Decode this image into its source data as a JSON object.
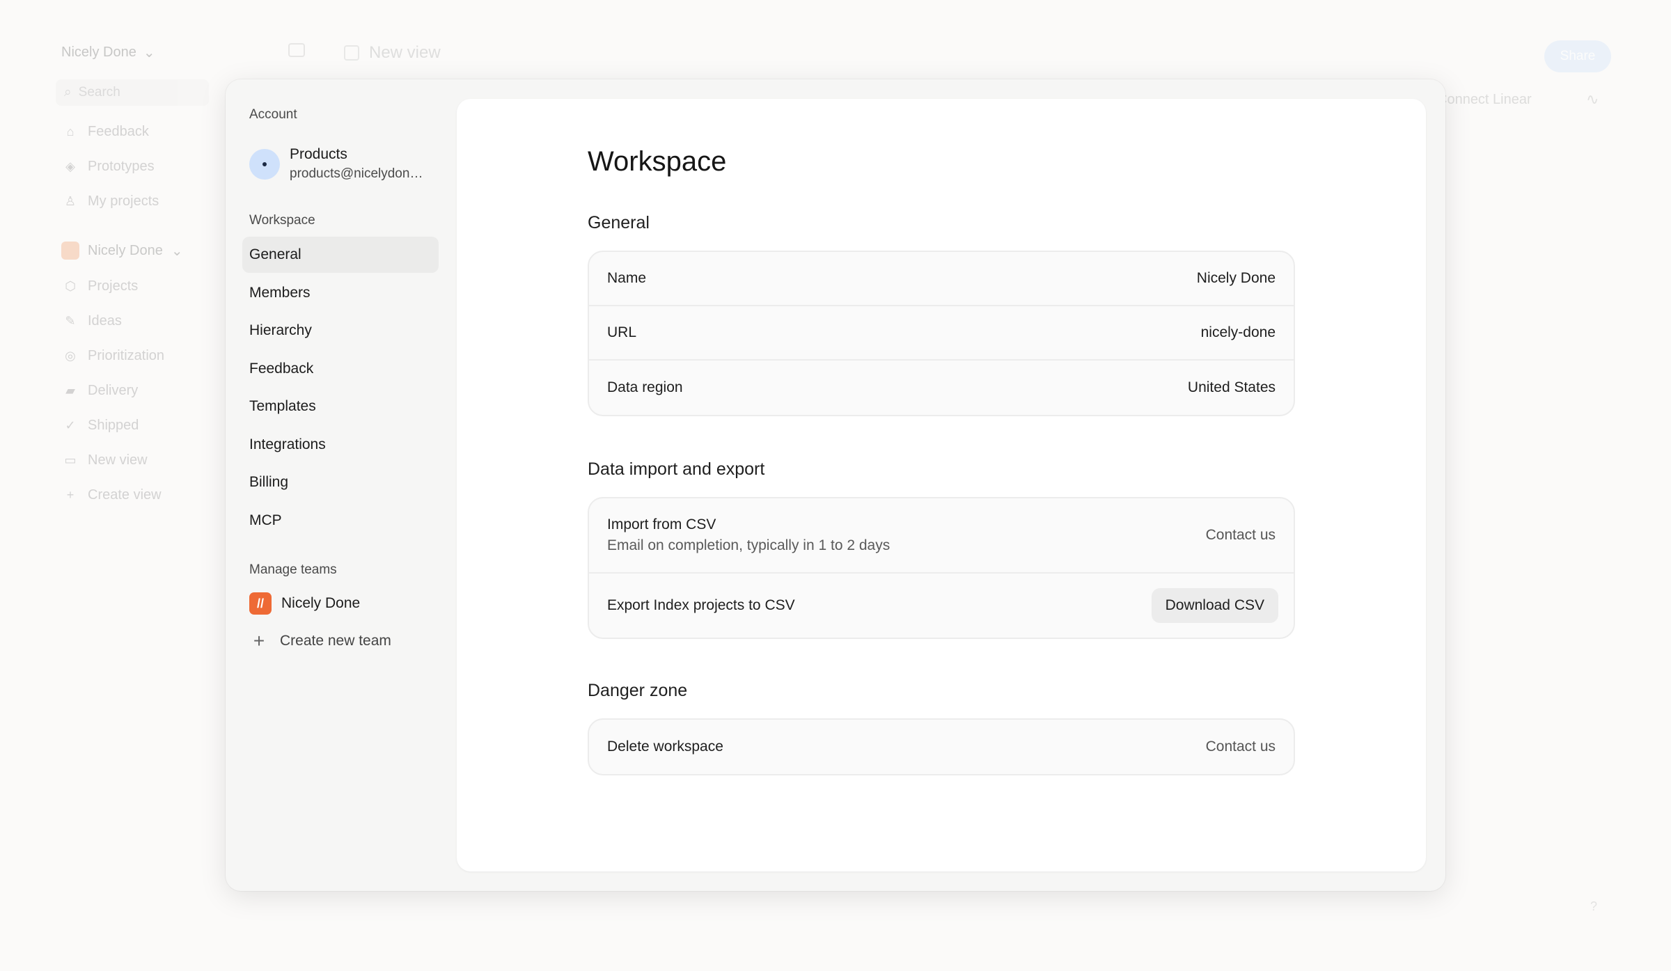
{
  "background": {
    "workspace_name": "Nicely Done",
    "search_placeholder": "Search",
    "nav_items": [
      "Feedback",
      "Prototypes",
      "My projects"
    ],
    "team_name": "Nicely Done",
    "team_items": [
      "Projects",
      "Ideas",
      "Prioritization",
      "Delivery",
      "Shipped",
      "New view",
      "Create view"
    ],
    "view_title": "New view",
    "share_label": "Share",
    "connect_linear_label": "Connect Linear",
    "help_label": "?"
  },
  "modal": {
    "nav": {
      "account_heading": "Account",
      "account_name": "Products",
      "account_email": "products@nicelydone.club",
      "workspace_heading": "Workspace",
      "items": [
        "General",
        "Members",
        "Hierarchy",
        "Feedback",
        "Templates",
        "Integrations",
        "Billing",
        "MCP"
      ],
      "active_item": "General",
      "teams_heading": "Manage teams",
      "team_name": "Nicely Done",
      "create_team_label": "Create new team"
    },
    "content": {
      "title": "Workspace",
      "general": {
        "heading": "General",
        "rows": [
          {
            "label": "Name",
            "value": "Nicely Done"
          },
          {
            "label": "URL",
            "value": "nicely-done"
          },
          {
            "label": "Data region",
            "value": "United States"
          }
        ]
      },
      "data": {
        "heading": "Data import and export",
        "import_label": "Import from CSV",
        "import_sublabel": "Email on completion, typically in 1 to 2 days",
        "import_action": "Contact us",
        "export_label": "Export Index projects to CSV",
        "export_action": "Download CSV"
      },
      "danger": {
        "heading": "Danger zone",
        "delete_label": "Delete workspace",
        "delete_action": "Contact us"
      }
    }
  }
}
